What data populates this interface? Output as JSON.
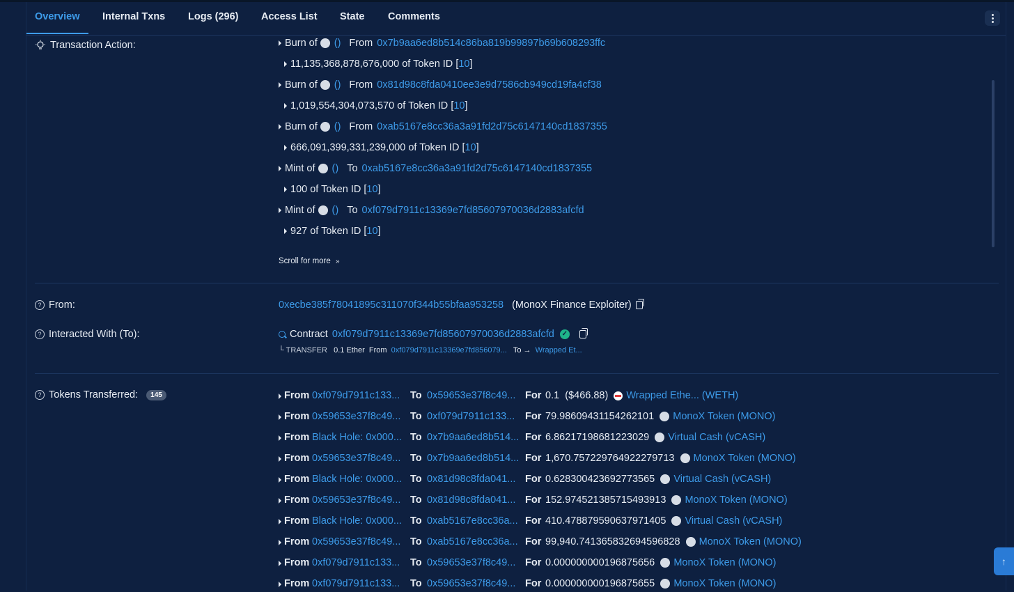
{
  "tabs": [
    {
      "label": "Overview",
      "active": true
    },
    {
      "label": "Internal Txns"
    },
    {
      "label": "Logs (296)"
    },
    {
      "label": "Access List"
    },
    {
      "label": "State"
    },
    {
      "label": "Comments"
    }
  ],
  "transaction_action": {
    "label": "Transaction Action:",
    "entries": [
      {
        "kind": "Burn of",
        "dir": "From",
        "addr": "0x7b9aa6ed8b514c86ba819b99897b69b608293ffc",
        "amount": "11,135,368,878,676,000",
        "token_id": "10"
      },
      {
        "kind": "Burn of",
        "dir": "From",
        "addr": "0x81d98c8fda0410ee3e9d7586cb949cd19fa4cf38",
        "amount": "1,019,554,304,073,570",
        "token_id": "10"
      },
      {
        "kind": "Burn of",
        "dir": "From",
        "addr": "0xab5167e8cc36a3a91fd2d75c6147140cd1837355",
        "amount": "666,091,399,331,239,000",
        "token_id": "10"
      },
      {
        "kind": "Mint of",
        "dir": "To",
        "addr": "0xab5167e8cc36a3a91fd2d75c6147140cd1837355",
        "amount": "100",
        "token_id": "10"
      },
      {
        "kind": "Mint of",
        "dir": "To",
        "addr": "0xf079d7911c13369e7fd85607970036d2883afcfd",
        "amount": "927",
        "token_id": "10"
      }
    ],
    "empty_parens": "()",
    "of_token_id": "of Token ID",
    "scroll_more": "Scroll for more"
  },
  "from": {
    "label": "From:",
    "addr": "0xecbe385f78041895c311070f344b55bfaa953258",
    "name": "(MonoX Finance Exploiter)"
  },
  "interacted": {
    "label": "Interacted With (To):",
    "prefix": "Contract",
    "addr": "0xf079d7911c13369e7fd85607970036d2883afcfd",
    "transfer_prefix": "└ TRANSFER",
    "transfer_amount": "0.1 Ether",
    "transfer_from_word": "From",
    "transfer_from": "0xf079d7911c13369e7fd856079...",
    "transfer_to_word": "To →",
    "transfer_to": "Wrapped Et..."
  },
  "tokens_transferred": {
    "label": "Tokens Transferred:",
    "count": "145",
    "from_word": "From",
    "to_word": "To",
    "for_word": "For",
    "rows": [
      {
        "from": "0xf079d7911c133...",
        "to": "0x59653e37f8c49...",
        "amount": "0.1",
        "usd": "($466.88)",
        "token": "Wrapped Ethe... (WETH)",
        "icon": "weth"
      },
      {
        "from": "0x59653e37f8c49...",
        "to": "0xf079d7911c133...",
        "amount": "79.98609431154262101",
        "usd": "",
        "token": "MonoX Token (MONO)",
        "icon": "dot"
      },
      {
        "from": "Black Hole: 0x000...",
        "to": "0x7b9aa6ed8b514...",
        "amount": "6.86217198681223029",
        "usd": "",
        "token": "Virtual Cash (vCASH)",
        "icon": "dot"
      },
      {
        "from": "0x59653e37f8c49...",
        "to": "0x7b9aa6ed8b514...",
        "amount": "1,670.757229764922279713",
        "usd": "",
        "token": "MonoX Token (MONO)",
        "icon": "dot"
      },
      {
        "from": "Black Hole: 0x000...",
        "to": "0x81d98c8fda041...",
        "amount": "0.628300423692773565",
        "usd": "",
        "token": "Virtual Cash (vCASH)",
        "icon": "dot"
      },
      {
        "from": "0x59653e37f8c49...",
        "to": "0x81d98c8fda041...",
        "amount": "152.974521385715493913",
        "usd": "",
        "token": "MonoX Token (MONO)",
        "icon": "dot"
      },
      {
        "from": "Black Hole: 0x000...",
        "to": "0xab5167e8cc36a...",
        "amount": "410.478879590637971405",
        "usd": "",
        "token": "Virtual Cash (vCASH)",
        "icon": "dot"
      },
      {
        "from": "0x59653e37f8c49...",
        "to": "0xab5167e8cc36a...",
        "amount": "99,940.741365832694596828",
        "usd": "",
        "token": "MonoX Token (MONO)",
        "icon": "dot"
      },
      {
        "from": "0xf079d7911c133...",
        "to": "0x59653e37f8c49...",
        "amount": "0.000000000196875656",
        "usd": "",
        "token": "MonoX Token (MONO)",
        "icon": "dot"
      },
      {
        "from": "0xf079d7911c133...",
        "to": "0x59653e37f8c49...",
        "amount": "0.000000000196875655",
        "usd": "",
        "token": "MonoX Token (MONO)",
        "icon": "dot"
      }
    ]
  }
}
